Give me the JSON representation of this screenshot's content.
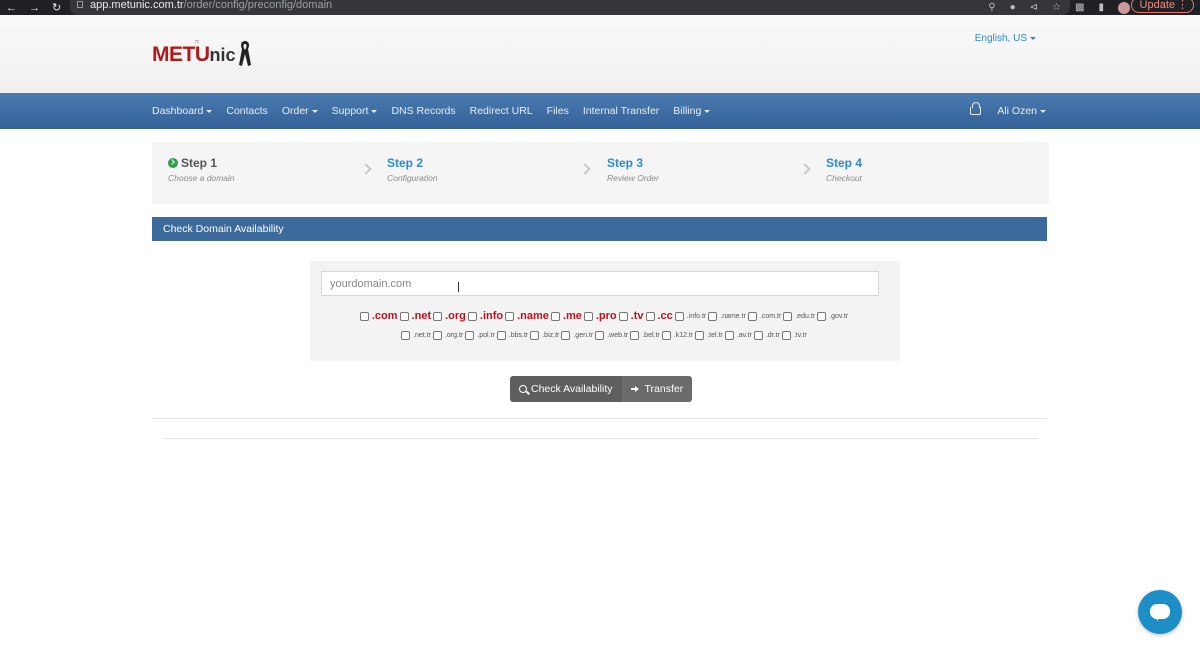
{
  "browser": {
    "url_host": "app.metunic.com.tr",
    "url_path": "/order/config/preconfig/domain",
    "update_label": "Update"
  },
  "header": {
    "logo_metu": "METU",
    "logo_nic": "nic",
    "language": "English, US"
  },
  "navbar": {
    "items": [
      "Dashboard",
      "Contacts",
      "Order",
      "Support",
      "DNS Records",
      "Redirect URL",
      "Files",
      "Internal Transfer",
      "Billing"
    ],
    "user": "Ali Ozen"
  },
  "steps": [
    {
      "title": "Step 1",
      "subtitle": "Choose a domain",
      "active": true
    },
    {
      "title": "Step 2",
      "subtitle": "Configuration"
    },
    {
      "title": "Step 3",
      "subtitle": "Review Order"
    },
    {
      "title": "Step 4",
      "subtitle": "Checkout"
    }
  ],
  "panel": {
    "title": "Check Domain Availability",
    "search_placeholder": "yourdomain.com"
  },
  "tlds_primary": [
    ".com",
    ".net",
    ".org",
    ".info",
    ".name",
    ".me",
    ".pro",
    ".tv",
    ".cc"
  ],
  "tlds_row1_small": [
    ".info.tr",
    ".name.tr",
    ".com.tr",
    ".edu.tr",
    ".gov.tr"
  ],
  "tlds_row2_small": [
    ".net.tr",
    ".org.tr",
    ".pol.tr",
    ".bbs.tr",
    ".biz.tr",
    ".gen.tr",
    ".web.tr",
    ".bel.tr",
    ".k12.tr",
    ".tel.tr",
    ".av.tr",
    ".dr.tr",
    ".tv.tr"
  ],
  "buttons": {
    "check": "Check Availability",
    "transfer": "Transfer"
  },
  "colors": {
    "navbar": "#3d6a9c",
    "accent_link": "#2c8ad3",
    "tld_primary": "#c0101a",
    "chat": "#1d8fc6"
  }
}
